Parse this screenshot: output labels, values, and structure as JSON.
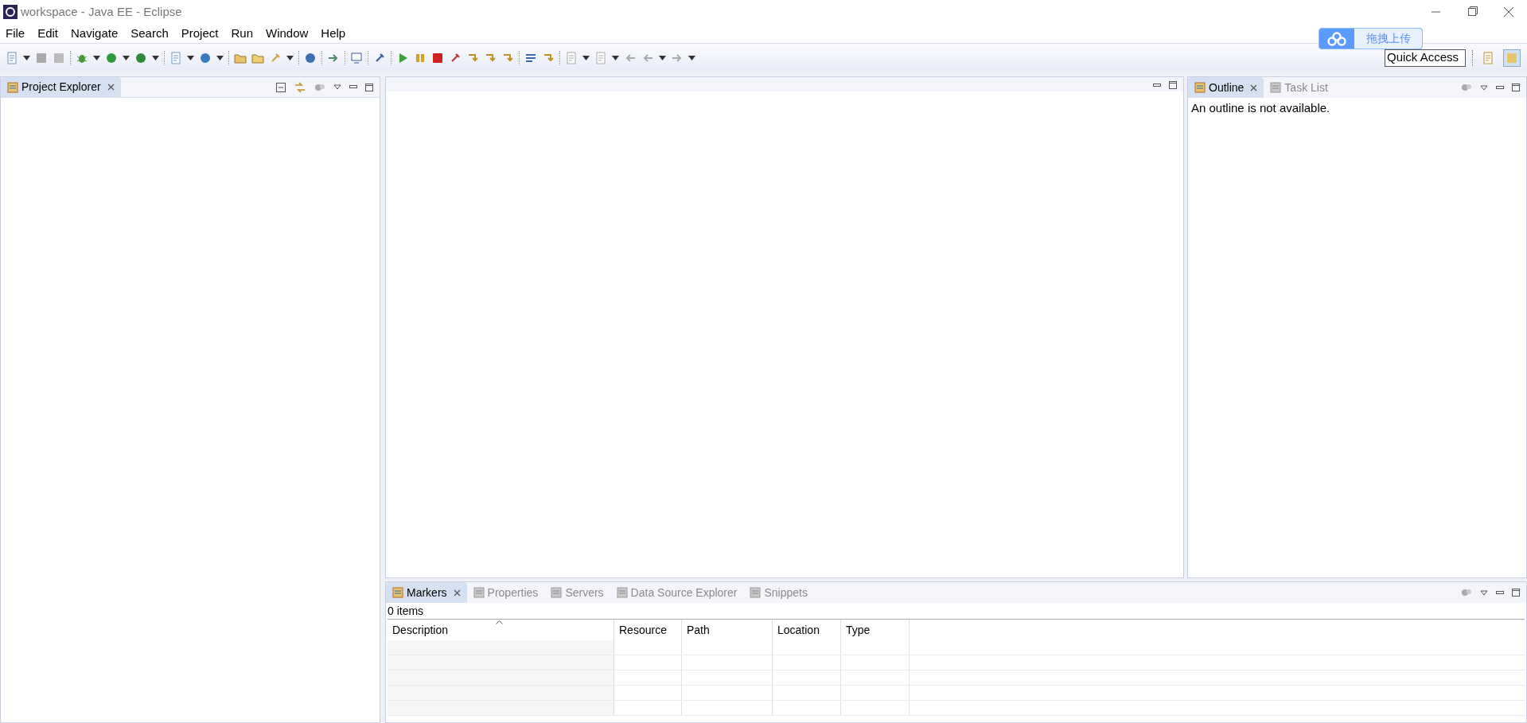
{
  "window": {
    "title": "workspace - Java EE - Eclipse"
  },
  "menu": [
    "File",
    "Edit",
    "Navigate",
    "Search",
    "Project",
    "Run",
    "Window",
    "Help"
  ],
  "upload_badge": {
    "label": "拖拽上传"
  },
  "quick_access": {
    "placeholder": "Quick Access"
  },
  "left_panel": {
    "tabs": [
      {
        "label": "Project Explorer",
        "selected": true
      }
    ]
  },
  "outline_panel": {
    "tabs": [
      {
        "label": "Outline",
        "selected": true
      },
      {
        "label": "Task List",
        "selected": false
      }
    ],
    "message": "An outline is not available."
  },
  "bottom_panel": {
    "tabs": [
      {
        "label": "Markers",
        "selected": true
      },
      {
        "label": "Properties",
        "selected": false
      },
      {
        "label": "Servers",
        "selected": false
      },
      {
        "label": "Data Source Explorer",
        "selected": false
      },
      {
        "label": "Snippets",
        "selected": false
      }
    ],
    "summary": "0 items",
    "table": {
      "columns": [
        {
          "label": "Description",
          "sorted": true
        },
        {
          "label": "Resource",
          "sorted": false
        },
        {
          "label": "Path",
          "sorted": false
        },
        {
          "label": "Location",
          "sorted": false
        },
        {
          "label": "Type",
          "sorted": false
        }
      ]
    }
  }
}
